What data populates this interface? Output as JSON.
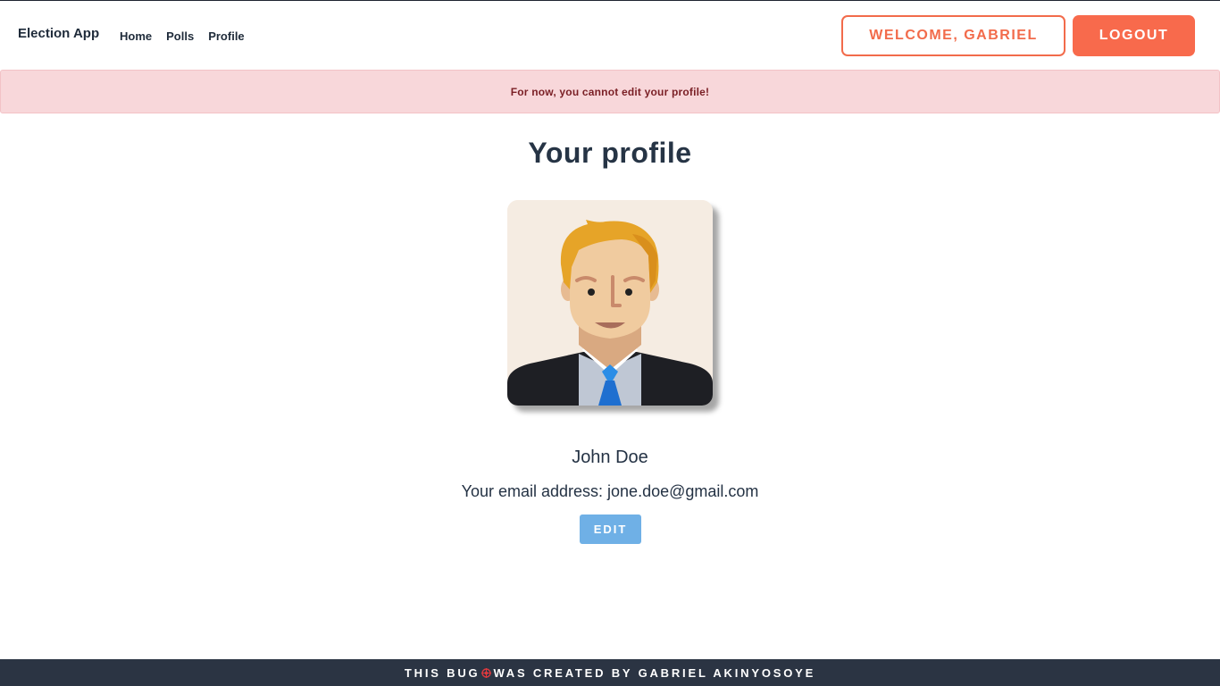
{
  "navbar": {
    "brand": "Election App",
    "links": [
      "Home",
      "Polls",
      "Profile"
    ],
    "welcome_label": "WELCOME, GABRIEL",
    "logout_label": "LOGOUT"
  },
  "alert": {
    "message": "For now, you cannot edit your profile!"
  },
  "profile": {
    "title": "Your profile",
    "avatar_icon": "user-avatar-icon",
    "name": "John Doe",
    "email_line": "Your email address: jone.doe@gmail.com",
    "edit_label": "EDIT"
  },
  "footer": {
    "text_before": "THIS BUG",
    "icon": "bug-icon",
    "text_after": "WAS CREATED BY GABRIEL AKINYOSOYE"
  },
  "colors": {
    "accent": "#f86a4c",
    "alert_bg": "#f8d7da",
    "alert_text": "#7a1f25",
    "edit_button": "#6fb0e6",
    "footer_bg": "#2b3443"
  }
}
